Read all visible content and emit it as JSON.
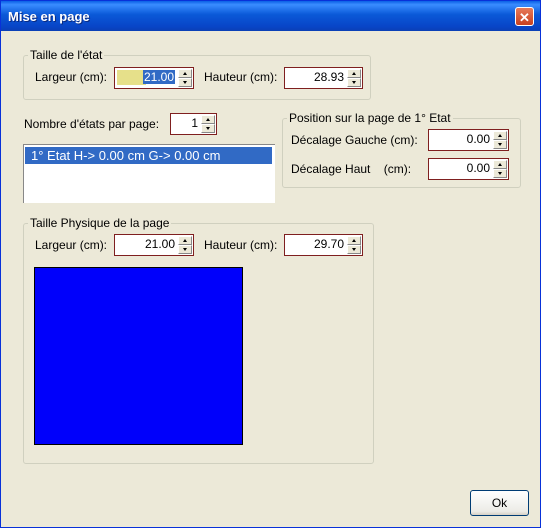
{
  "window": {
    "title": "Mise en page",
    "close_glyph": "✕"
  },
  "taille_etat": {
    "legend": "Taille de l'état",
    "largeur_label": "Largeur (cm):",
    "largeur_value": "21.00",
    "hauteur_label": "Hauteur (cm):",
    "hauteur_value": "28.93"
  },
  "nombre_etats": {
    "label": "Nombre d'états par page:",
    "value": "1"
  },
  "list": {
    "items": [
      "1° Etat H->  0.00 cm   G->  0.00 cm"
    ]
  },
  "position": {
    "legend": "Position sur la page de 1° Etat",
    "gauche_label": "Décalage Gauche (cm):",
    "gauche_value": "0.00",
    "haut_label": "Décalage Haut    (cm):",
    "haut_value": "0.00"
  },
  "taille_physique": {
    "legend": "Taille Physique de la page",
    "largeur_label": "Largeur (cm):",
    "largeur_value": "21.00",
    "hauteur_label": "Hauteur (cm):",
    "hauteur_value": "29.70"
  },
  "buttons": {
    "ok": "Ok"
  },
  "colors": {
    "preview_fill": "#0000fb",
    "selection": "#316ac5",
    "title_bar": "#0a59d8"
  }
}
